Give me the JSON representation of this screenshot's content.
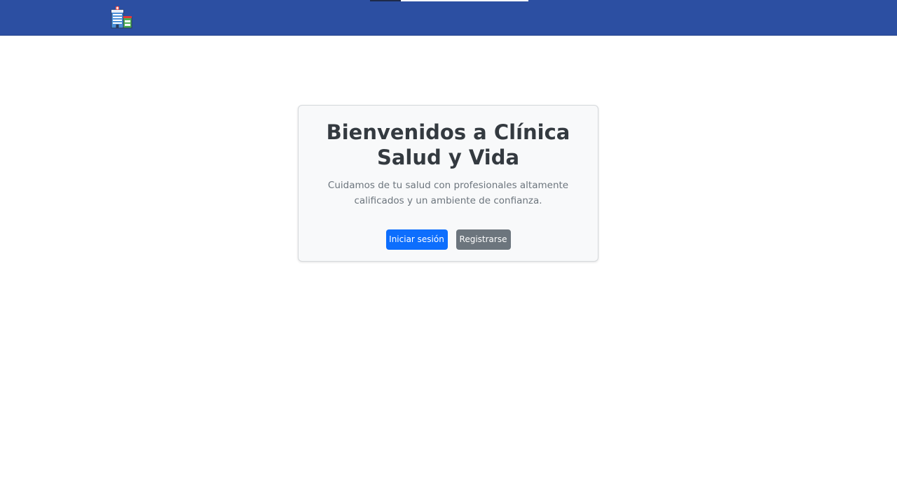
{
  "navbar": {
    "brand_icon": "hospital-icon",
    "background": "#2c4fa2"
  },
  "welcome": {
    "title": "Bienvenidos a Clínica Salud y Vida",
    "description": "Cuidamos de tu salud con profesionales altamente calificados y un ambiente de confianza.",
    "login_label": "Iniciar sesión",
    "register_label": "Registrarse",
    "login_color": "#0d6efd",
    "register_color": "#6c757d"
  }
}
